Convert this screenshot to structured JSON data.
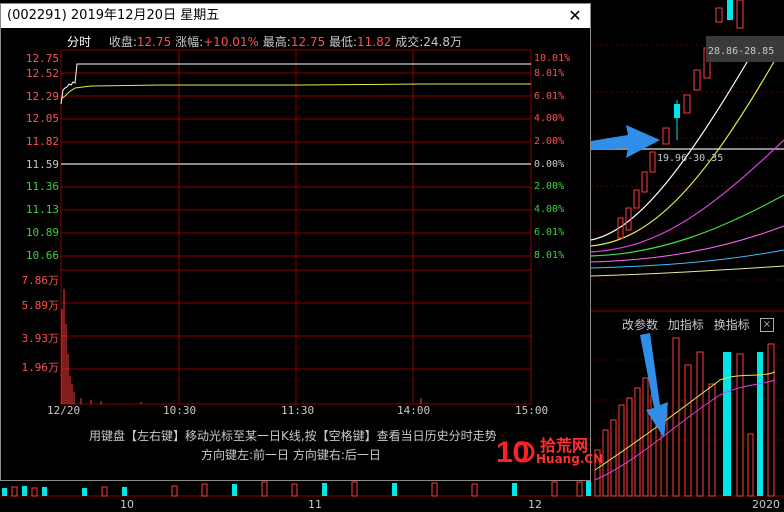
{
  "popup": {
    "title": "(002291) 2019年12月20日 星期五",
    "close_label": "✕",
    "info": {
      "tab_label": "分时",
      "close_label": "收盘:",
      "close_value": "12.75",
      "change_label": "涨幅:",
      "change_value": "+10.01%",
      "high_label": "最高:",
      "high_value": "12.75",
      "low_label": "最低:",
      "low_value": "11.82",
      "volume_label": "成交:",
      "volume_value": "24.8万"
    },
    "price_axis": [
      "12.75",
      "12.52",
      "12.29",
      "12.05",
      "11.82",
      "11.59",
      "11.36",
      "11.13",
      "10.89",
      "10.66"
    ],
    "pct_axis": [
      "10.01%",
      "8.01%",
      "6.01%",
      "4.00%",
      "2.00%",
      "0.00%",
      "2.00%",
      "4.00%",
      "6.01%",
      "8.01%"
    ],
    "volume_axis": [
      "7.86万",
      "5.89万",
      "3.93万",
      "1.96万"
    ],
    "time_axis": [
      "12/20",
      "10:30",
      "11:30",
      "14:00",
      "15:00"
    ],
    "hint_line1": "用键盘【左右键】移动光标至某一日K线,按【空格键】查看当日历史分时走势",
    "hint_line2": "方向键左:前一日   方向键右:后一日"
  },
  "background": {
    "price_tag_1": "28.86-28.85",
    "price_tag_2": "19.96-30.35",
    "indicator_toolbar": [
      "改参数",
      "加指标",
      "换指标"
    ],
    "indicator_close": "×",
    "date_labels": [
      "10",
      "11",
      "12",
      "2020"
    ]
  },
  "watermark": {
    "text1": "拾荒网",
    "text2": "Huang.CN",
    "number": "10"
  },
  "colors": {
    "up": "#ff3a3a",
    "down": "#00e5e5",
    "price_line": "#ffffff",
    "avg_line": "#e8e84a",
    "grid": "#8b0000",
    "arrow": "#2f8fe8"
  }
}
